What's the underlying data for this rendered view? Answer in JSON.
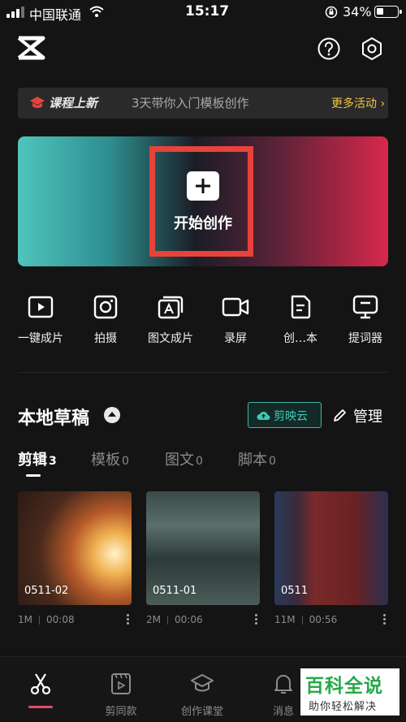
{
  "status_bar": {
    "carrier": "中国联通",
    "time": "15:17",
    "battery": "34%",
    "battery_level": 0.34
  },
  "header": {
    "logo": "capcut-logo-icon",
    "help_icon": "help-icon",
    "settings_icon": "settings-icon"
  },
  "course_banner": {
    "tag": "课程上新",
    "text": "3天带你入门模板创作",
    "link": "更多活动 ›"
  },
  "hero": {
    "label": "开始创作"
  },
  "tools": [
    {
      "label": "一键成片",
      "icon": "play-icon"
    },
    {
      "label": "拍摄",
      "icon": "camera-icon"
    },
    {
      "label": "图文成片",
      "icon": "image-text-icon"
    },
    {
      "label": "录屏",
      "icon": "record-icon"
    },
    {
      "label": "创…本",
      "icon": "script-icon"
    },
    {
      "label": "提词器",
      "icon": "teleprompter-icon"
    }
  ],
  "drafts": {
    "title": "本地草稿",
    "cloud_label": "剪映云",
    "manage_label": "管理",
    "tabs": [
      {
        "label": "剪辑",
        "count": "3",
        "active": true
      },
      {
        "label": "模板",
        "count": "0",
        "active": false
      },
      {
        "label": "图文",
        "count": "0",
        "active": false
      },
      {
        "label": "脚本",
        "count": "0",
        "active": false
      }
    ],
    "items": [
      {
        "name": "0511-02",
        "size": "1M",
        "duration": "00:08"
      },
      {
        "name": "0511-01",
        "size": "2M",
        "duration": "00:06"
      },
      {
        "name": "0511",
        "size": "11M",
        "duration": "00:56"
      }
    ]
  },
  "bottom_nav": [
    {
      "label": "",
      "icon": "scissors-icon",
      "active": true
    },
    {
      "label": "剪同款",
      "icon": "template-icon"
    },
    {
      "label": "创作课堂",
      "icon": "graduation-cap-icon"
    },
    {
      "label": "消息",
      "icon": "bell-icon"
    }
  ],
  "watermark": {
    "title": "百科全说",
    "subtitle": "助你轻松解决"
  }
}
